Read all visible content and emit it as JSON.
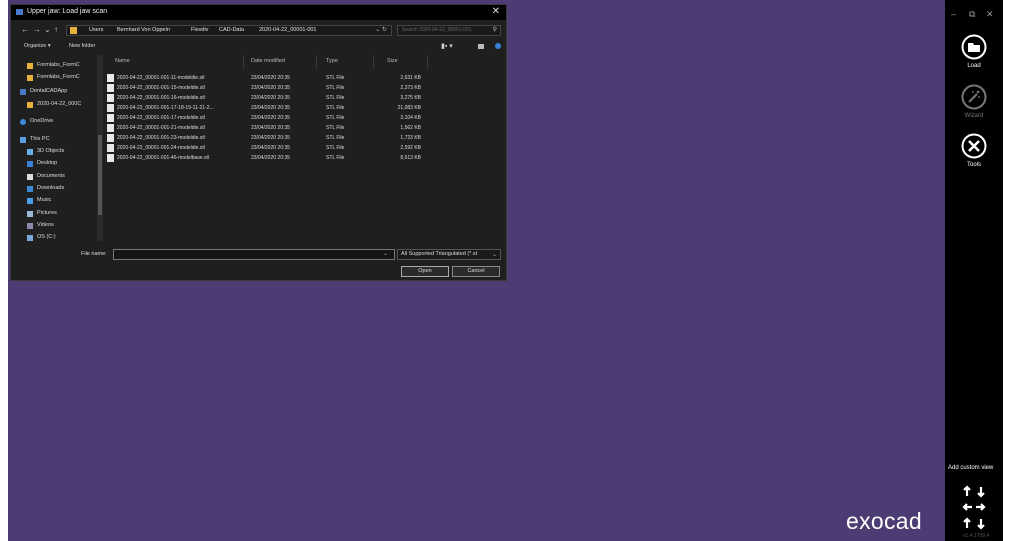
{
  "dialog": {
    "title": "Upper jaw: Load jaw scan",
    "close": "✕",
    "nav": {
      "back": "←",
      "forward": "→",
      "up": "↑",
      "recent": "⌄"
    },
    "breadcrumb": [
      "Users",
      "Bernhard Von Oppeln",
      "Flexdiv",
      "CAD-Data",
      "2020-04-22_00001-001"
    ],
    "search_placeholder": "Search 2020-04-22_00001-001",
    "organize": "Organize ▾",
    "new_folder": "New folder",
    "navpane": [
      {
        "label": "Formlabs_FormC",
        "icon": "folder"
      },
      {
        "label": "Formlabs_FormC",
        "icon": "folder"
      },
      {
        "label": "DentalCADApp",
        "icon": "drive"
      },
      {
        "label": "2020-04-22_000C",
        "icon": "folder"
      },
      {
        "label": "OneDrive",
        "icon": "cloud"
      },
      {
        "label": "This PC",
        "icon": "pc"
      },
      {
        "label": "3D Objects",
        "icon": "cube"
      },
      {
        "label": "Desktop",
        "icon": "desktop"
      },
      {
        "label": "Documents",
        "icon": "doc"
      },
      {
        "label": "Downloads",
        "icon": "download"
      },
      {
        "label": "Music",
        "icon": "music"
      },
      {
        "label": "Pictures",
        "icon": "picture"
      },
      {
        "label": "Videos",
        "icon": "video"
      },
      {
        "label": "OS (C:)",
        "icon": "disk"
      }
    ],
    "columns": {
      "name": "Name",
      "date": "Date modified",
      "type": "Type",
      "size": "Size"
    },
    "files": [
      {
        "name": "2020-04-22_00001-001-11-modeldie.stl",
        "date": "23/04/2020 20:35",
        "type": "STL File",
        "size": "2,631 KB"
      },
      {
        "name": "2020-04-22_00001-001-15-modeldie.stl",
        "date": "23/04/2020 20:35",
        "type": "STL File",
        "size": "2,373 KB"
      },
      {
        "name": "2020-04-22_00001-001-16-modeldie.stl",
        "date": "23/04/2020 20:35",
        "type": "STL File",
        "size": "3,275 KB"
      },
      {
        "name": "2020-04-22_00001-001-17-18-19-11-21-2...",
        "date": "23/04/2020 20:35",
        "type": "STL File",
        "size": "21,083 KB"
      },
      {
        "name": "2020-04-22_00001-001-17-modeldie.stl",
        "date": "23/04/2020 20:35",
        "type": "STL File",
        "size": "3,104 KB"
      },
      {
        "name": "2020-04-22_00001-001-21-modeldie.stl",
        "date": "23/04/2020 20:35",
        "type": "STL File",
        "size": "1,562 KB"
      },
      {
        "name": "2020-04-22_00001-001-23-modeldie.stl",
        "date": "23/04/2020 20:35",
        "type": "STL File",
        "size": "1,723 KB"
      },
      {
        "name": "2020-04-22_00001-001-24-modeldie.stl",
        "date": "23/04/2020 20:35",
        "type": "STL File",
        "size": "2,592 KB"
      },
      {
        "name": "2020-04-22_00001-001-46-modelbase.stl",
        "date": "23/04/2020 20:35",
        "type": "STL File",
        "size": "8,613 KB"
      }
    ],
    "file_name_label": "File name:",
    "file_name_value": "",
    "filter": "All Supported Triangulated (*.st",
    "open": "Open",
    "cancel": "Cancel"
  },
  "toolbar": {
    "window_controls": [
      "–",
      "⧉",
      "✕"
    ],
    "tools": [
      {
        "label": "Load",
        "icon": "load-icon"
      },
      {
        "label": "Wizard",
        "icon": "wizard-icon"
      },
      {
        "label": "Tools",
        "icon": "tools-icon"
      }
    ],
    "custom_view": "Add custom view",
    "version": "v1.4.1709.4"
  },
  "brand": "exocad",
  "colors": {
    "workspace": "#4c3c73",
    "toolbar": "#000000",
    "dialog": "#1f1f1f"
  }
}
